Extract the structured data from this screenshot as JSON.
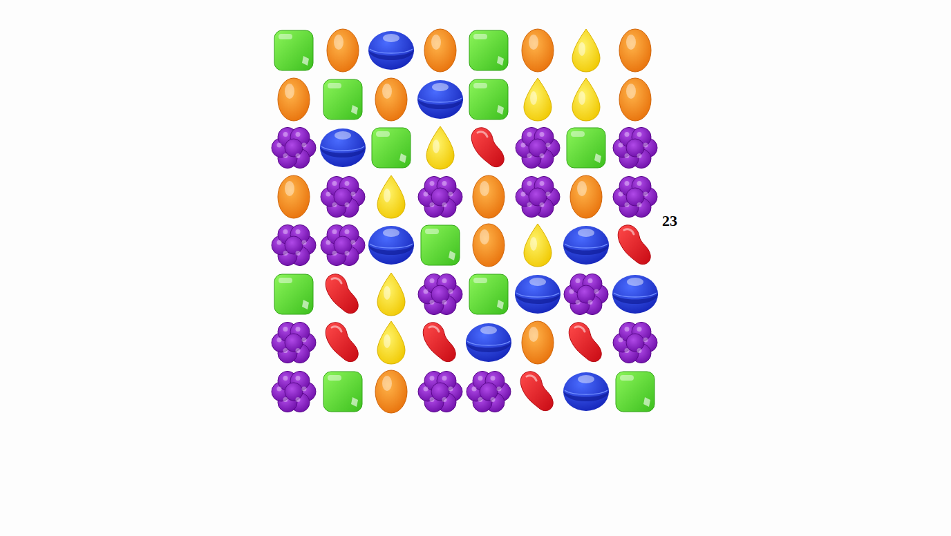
{
  "board": {
    "rows": [
      [
        {
          "kind": "square"
        },
        {
          "kind": "oval"
        },
        {
          "kind": "ball"
        },
        {
          "kind": "oval"
        },
        {
          "kind": "square"
        },
        {
          "kind": "oval"
        },
        {
          "kind": "drop"
        },
        {
          "kind": "oval"
        }
      ],
      [
        {
          "kind": "oval"
        },
        {
          "kind": "square"
        },
        {
          "kind": "oval"
        },
        {
          "kind": "ball"
        },
        {
          "kind": "square"
        },
        {
          "kind": "drop"
        },
        {
          "kind": "drop"
        },
        {
          "kind": "oval"
        }
      ],
      [
        {
          "kind": "flower"
        },
        {
          "kind": "ball"
        },
        {
          "kind": "square"
        },
        {
          "kind": "drop"
        },
        {
          "kind": "bean"
        },
        {
          "kind": "flower"
        },
        {
          "kind": "square"
        },
        {
          "kind": "flower"
        }
      ],
      [
        {
          "kind": "oval"
        },
        {
          "kind": "flower"
        },
        {
          "kind": "drop"
        },
        {
          "kind": "flower"
        },
        {
          "kind": "oval"
        },
        {
          "kind": "flower"
        },
        {
          "kind": "oval"
        },
        {
          "kind": "flower"
        }
      ],
      [
        {
          "kind": "flower"
        },
        {
          "kind": "flower"
        },
        {
          "kind": "ball"
        },
        {
          "kind": "square"
        },
        {
          "kind": "oval"
        },
        {
          "kind": "drop"
        },
        {
          "kind": "ball"
        },
        {
          "kind": "bean"
        }
      ],
      [
        {
          "kind": "square"
        },
        {
          "kind": "bean"
        },
        {
          "kind": "drop"
        },
        {
          "kind": "flower"
        },
        {
          "kind": "square"
        },
        {
          "kind": "ball"
        },
        {
          "kind": "flower"
        },
        {
          "kind": "ball"
        }
      ],
      [
        {
          "kind": "flower"
        },
        {
          "kind": "bean"
        },
        {
          "kind": "drop"
        },
        {
          "kind": "bean"
        },
        {
          "kind": "ball"
        },
        {
          "kind": "oval"
        },
        {
          "kind": "bean"
        },
        {
          "kind": "flower"
        }
      ],
      [
        {
          "kind": "flower"
        },
        {
          "kind": "square"
        },
        {
          "kind": "oval"
        },
        {
          "kind": "flower"
        },
        {
          "kind": "flower"
        },
        {
          "kind": "bean"
        },
        {
          "kind": "ball"
        },
        {
          "kind": "square"
        }
      ]
    ]
  },
  "score": "23"
}
